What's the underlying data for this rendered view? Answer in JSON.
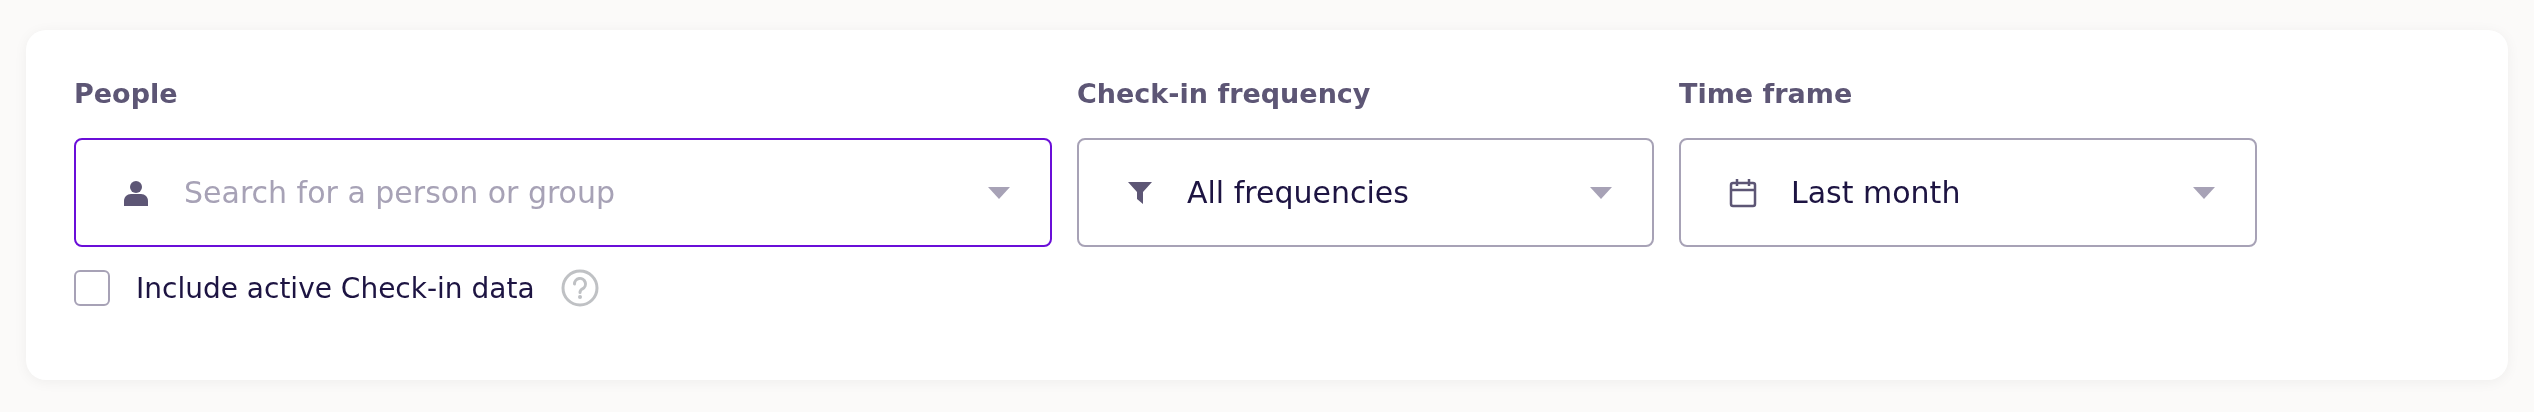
{
  "filters": [
    {
      "label": "People",
      "kind": "search",
      "placeholder": "Search for a person or group",
      "focused": true
    },
    {
      "label": "Check-in frequency",
      "kind": "select",
      "value": "All frequencies",
      "focused": false
    },
    {
      "label": "Time frame",
      "kind": "select",
      "value": "Last month",
      "focused": false
    }
  ],
  "include_active": {
    "label": "Include active Check-in data",
    "checked": false
  }
}
